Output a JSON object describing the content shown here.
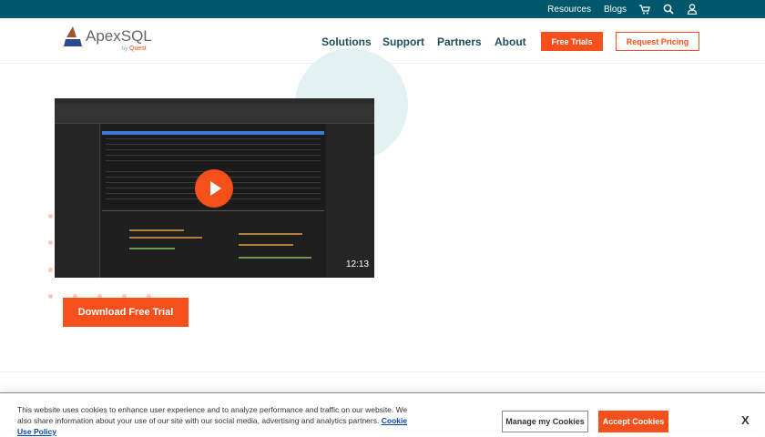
{
  "topbar": {
    "resources": "Resources",
    "blogs": "Blogs"
  },
  "logo": {
    "name": "ApexSQL",
    "by": "by",
    "brand": "Quest"
  },
  "nav": {
    "solutions": "Solutions",
    "support": "Support",
    "partners": "Partners",
    "about": "About",
    "free_trials": "Free Trials",
    "request_pricing": "Request Pricing"
  },
  "video": {
    "duration": "12:13"
  },
  "hero": {
    "download": "Download Free Trial"
  },
  "cookie": {
    "text": "This website uses cookies to enhance user experience and to analyze performance and traffic on our website. We also share information about your use of our site with our social media, advertising and analytics partners.",
    "link": "Cookie Use Policy",
    "manage": "Manage my Cookies",
    "accept": "Accept Cookies",
    "close": "X"
  },
  "colors": {
    "teal": "#00566b",
    "accent": "#f5501c"
  }
}
